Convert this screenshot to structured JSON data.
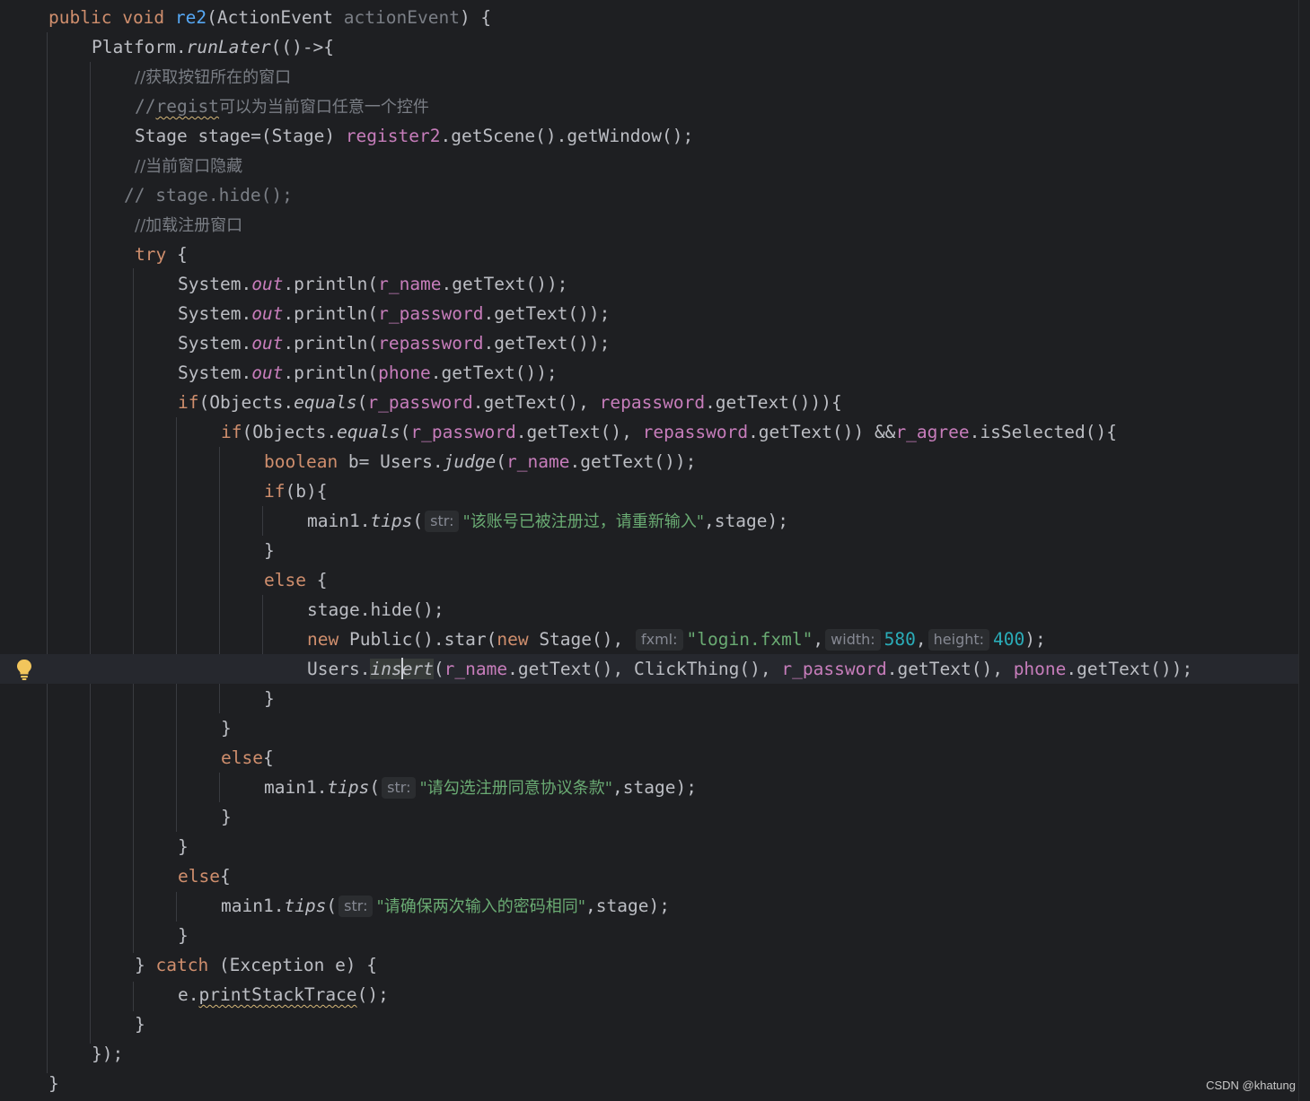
{
  "editor": {
    "lines": [
      "public void re2(ActionEvent actionEvent) {",
      "    Platform.runLater(()->{",
      "        //获取按钮所在的窗口",
      "        //regist可以为当前窗口任意一个控件",
      "        Stage stage=(Stage) register2.getScene().getWindow();",
      "        //当前窗口隐藏",
      "       // stage.hide();",
      "        //加载注册窗口",
      "        try {",
      "            System.out.println(r_name.getText());",
      "            System.out.println(r_password.getText());",
      "            System.out.println(repassword.getText());",
      "            System.out.println(phone.getText());",
      "            if(Objects.equals(r_password.getText(), repassword.getText())){",
      "                if(Objects.equals(r_password.getText(), repassword.getText()) &&r_agree.isSelected()){",
      "                    boolean b= Users.judge(r_name.getText());",
      "                    if(b){",
      "                        main1.tips( str: \"该账号已被注册过，请重新输入\",stage);",
      "                    }",
      "                    else {",
      "                        stage.hide();",
      "                        new Public().star(new Stage(), fxml: \"login.fxml\", width: 580, height: 400);",
      "                        Users.insert(r_name.getText(), ClickThing(), r_password.getText(), phone.getText());",
      "                    }",
      "                }",
      "                else{",
      "                    main1.tips( str: \"请勾选注册同意协议条款\",stage);",
      "                }",
      "            }",
      "            else{",
      "                main1.tips( str: \"请确保两次输入的密码相同\",stage);",
      "            }",
      "        } catch (Exception e) {",
      "            e.printStackTrace();",
      "        }",
      "    });",
      "}"
    ],
    "t": {
      "public": "public",
      "void": "void",
      "re2": "re2",
      "actionEventType": "ActionEvent",
      "actionEvent": "actionEvent",
      "platform": "Platform",
      "runLater": "runLater",
      "lambda": "(()->{",
      "c1": "//获取按钮所在的窗口",
      "c2slash": "//",
      "c2regist": "regist",
      "c2rest": "可以为当前窗口任意一个控件",
      "stageDecl": "Stage stage=(Stage) ",
      "register2": "register2",
      "getSceneWin": ".getScene().getWindow();",
      "c3": "//当前窗口隐藏",
      "c4": "// stage.hide();",
      "c5": "//加载注册窗口",
      "try": "try",
      "brace": " {",
      "system": "System.",
      "out": "out",
      "println": ".println(",
      "rname": "r_name",
      "rpassword": "r_password",
      "repassword": "repassword",
      "phone": "phone",
      "getTextEnd": ".getText());",
      "if": "if",
      "objects": "(Objects.",
      "equals": "equals",
      "paren": "(",
      "getTextComma": ".getText(), ",
      "getTextClose2": ".getText())){",
      "getTextAnd": ".getText()) &&",
      "ragree": "r_agree",
      "isSelected": ".isSelected(){",
      "boolean": "boolean",
      "bEq": " b= Users.",
      "judge": "judge",
      "ifB": "(b){",
      "main1": "main1.",
      "tips": "tips",
      "tipsParen": "( ",
      "strHint": "str:",
      "s1": "\"该账号已被注册过，请重新输入\"",
      "stageEnd": ",stage);",
      "closeBrace": "}",
      "else": "else",
      "elseBrace": " {",
      "elseBrace2": "{",
      "stageHide": "stage.hide();",
      "new": "new",
      "publicStar": " Public().star(",
      "stageCall": " Stage(), ",
      "fxmlHint": "fxml:",
      "loginFxml": "\"login.fxml\"",
      "comma": ",",
      "widthHint": "width:",
      "w580": "580",
      "heightHint": "height:",
      "h400": "400",
      "closeSemi": ");",
      "usersDot": "Users.",
      "ins": "ins",
      "ert": "ert",
      "clickThing": "ClickThing(), ",
      "s2": "\"请勾选注册同意协议条款\"",
      "s3": "\"请确保两次输入的密码相同\"",
      "catchOpen": "} ",
      "catch": "catch",
      "exception": " (Exception e) {",
      "eDot": "e.",
      "printStackTrace": "printStackTrace",
      "pstEnd": "();",
      "closeLambda": "});"
    }
  },
  "watermark": "CSDN @khatung",
  "colors": {
    "background": "#1e1f22",
    "keyword": "#cf8e6d",
    "method": "#56a8f5",
    "field": "#c77dbb",
    "string": "#6aab73",
    "number": "#2aacb8",
    "comment": "#7a7e85",
    "text": "#bcbec4"
  },
  "icons": [
    "intention-bulb-icon"
  ]
}
